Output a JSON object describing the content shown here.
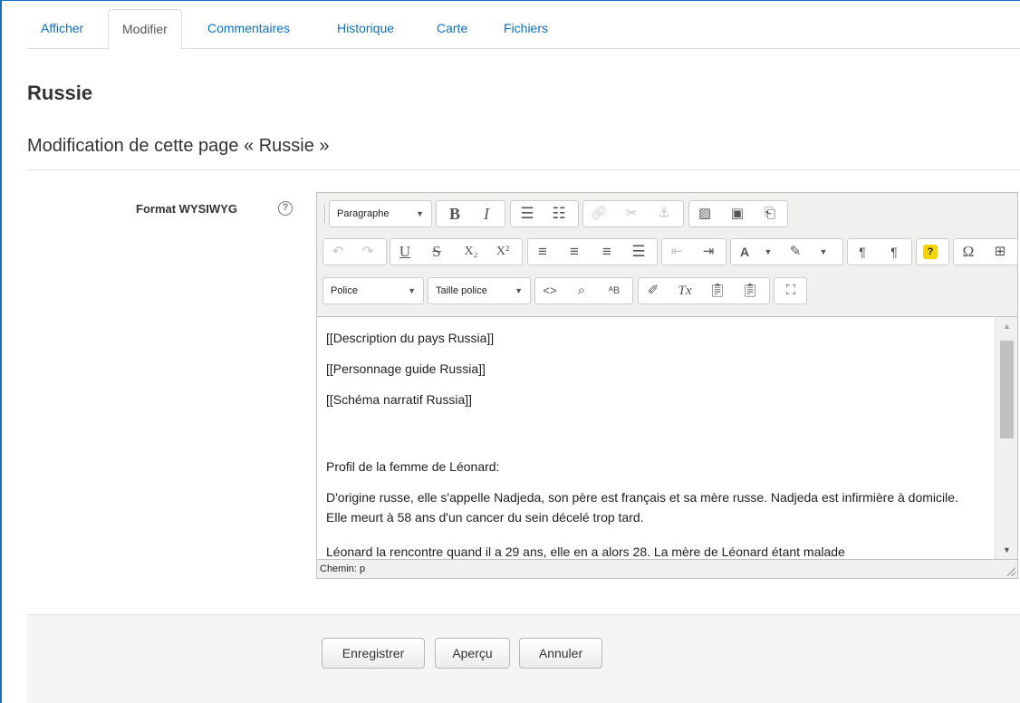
{
  "tabs": [
    {
      "label": "Afficher",
      "active": false
    },
    {
      "label": "Modifier",
      "active": true
    },
    {
      "label": "Commentaires",
      "active": false
    },
    {
      "label": "Historique",
      "active": false
    },
    {
      "label": "Carte",
      "active": false
    },
    {
      "label": "Fichiers",
      "active": false
    }
  ],
  "page": {
    "title": "Russie",
    "subtitle": "Modification de cette page « Russie »"
  },
  "form": {
    "field_label": "Format WYSIWYG",
    "help_glyph": "?"
  },
  "editor": {
    "format_select": "Paragraphe",
    "font_select": "Police",
    "size_select": "Taille police",
    "paragraphs": [
      "[[Description du pays Russia]]",
      "[[Personnage guide Russia]]",
      "[[Schéma narratif Russia]]",
      "",
      "Profil de la femme de Léonard:",
      "D'origine russe, elle s'appelle Nadjeda, son père est français et sa mère russe. Nadjeda est infirmière à domicile. Elle meurt à 58 ans d'un cancer du sein décelé trop tard.",
      "Léonard la rencontre quand il a 29 ans, elle en a alors 28. La mère de Léonard étant malade"
    ],
    "status_path": "Chemin: p"
  },
  "footer": {
    "save": "Enregistrer",
    "preview": "Aperçu",
    "cancel": "Annuler"
  },
  "colors": {
    "link": "#0f6fc5",
    "frame": "#0f6fc5"
  }
}
